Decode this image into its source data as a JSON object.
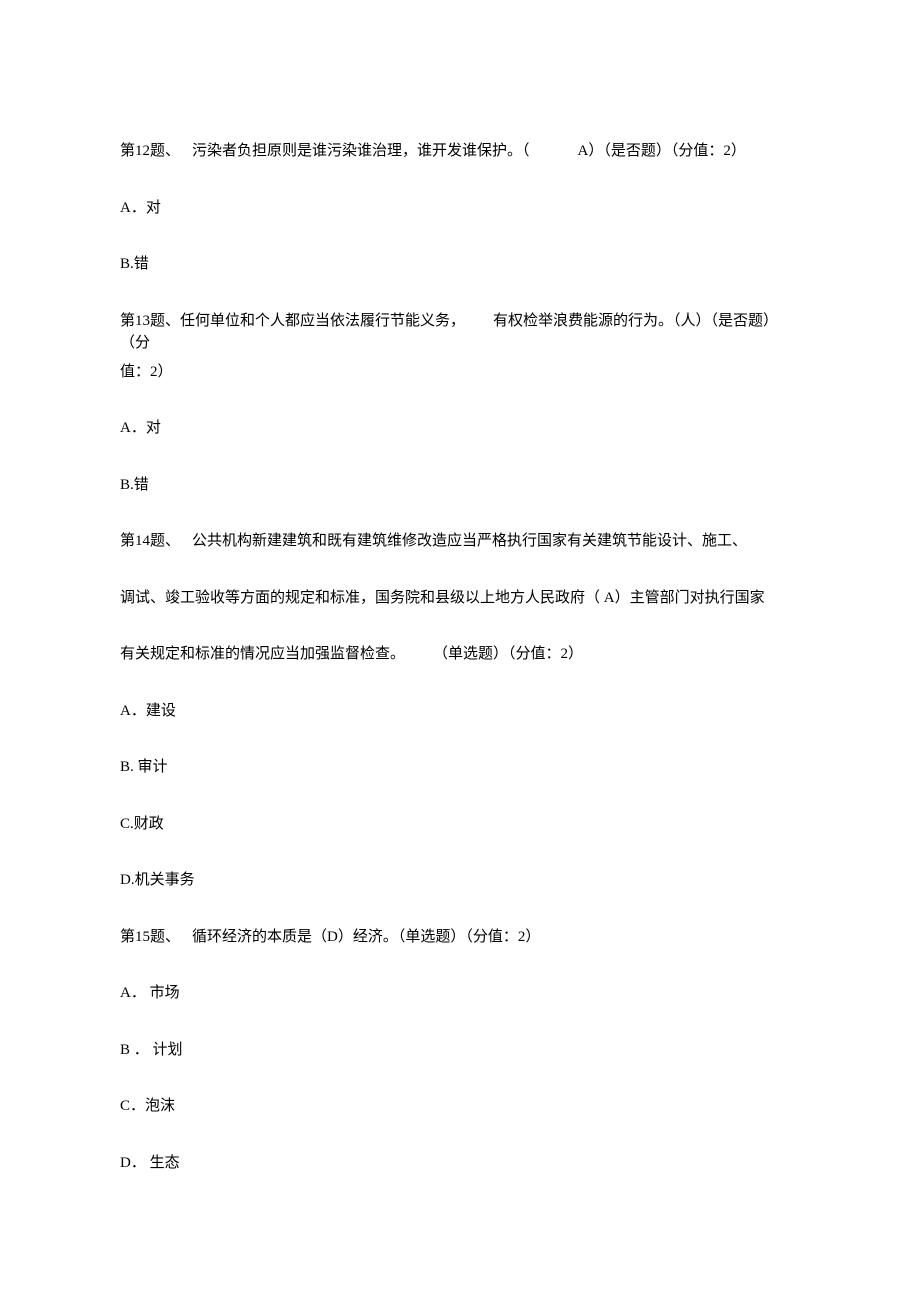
{
  "q12": {
    "prefix": "第12题、",
    "text_a": "污染者负担原则是谁污染谁治理，谁开发谁保护。（",
    "answer": "A）（是否题）（分值：2）",
    "optA": "A．对",
    "optB": "B.错"
  },
  "q13": {
    "prefix": "第13题、任何单位和个人都应当依法履行节能义务，",
    "text_b": "有权检举浪费能源的行为。（人）（是否题）（分",
    "text_c": "值：2）",
    "optA": "A．对",
    "optB": "B.错"
  },
  "q14": {
    "prefix": "第14题、",
    "line1": "公共机构新建建筑和既有建筑维修改造应当严格执行国家有关建筑节能设计、施工、",
    "line2": "调试、竣工验收等方面的规定和标准，国务院和县级以上地方人民政府（ A）主管部门对执行国家",
    "line3a": "有关规定和标准的情况应当加强监督检查。",
    "line3b": "（单选题）（分值：2）",
    "optA": "A．建设",
    "optB": "B. 审计",
    "optC": "C.财政",
    "optD": "D.机关事务"
  },
  "q15": {
    "prefix": "第15题、",
    "text": "循环经济的本质是（D）经济。（单选题）（分值：2）",
    "optA": "A． 市场",
    "optB": "B ． 计划",
    "optC": "C．泡沫",
    "optD": "D． 生态"
  }
}
